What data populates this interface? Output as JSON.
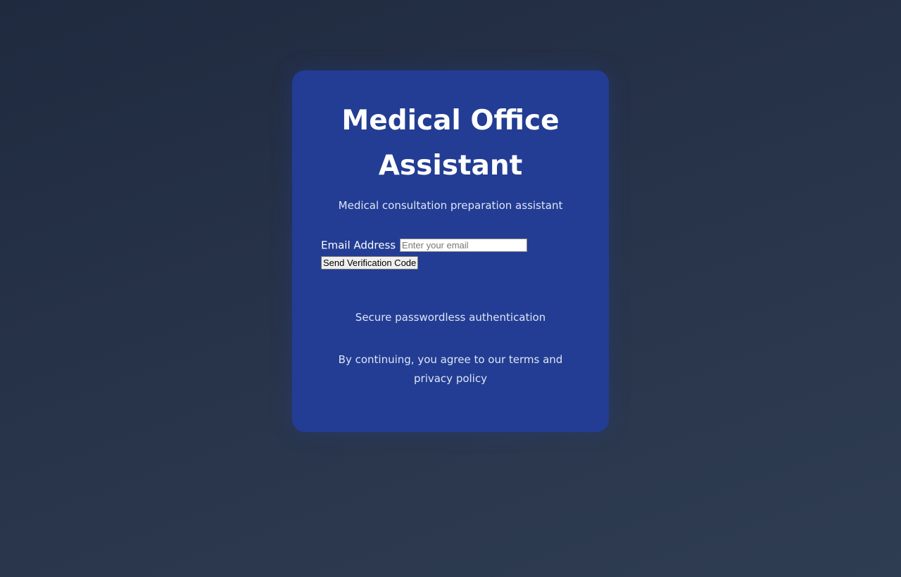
{
  "app": {
    "title": "Medical Office Assistant",
    "subtitle": "Medical consultation preparation assistant"
  },
  "form": {
    "email_label": "Email Address",
    "email_value": "",
    "email_placeholder": "Enter your email",
    "send_label": "Send Verification Code"
  },
  "footer": {
    "secure_text": "Secure passwordless authentication",
    "terms_text": "By continuing, you agree to our terms and privacy policy"
  },
  "colors": {
    "background": "#273349",
    "card": "#223d93",
    "text": "#ffffff"
  }
}
